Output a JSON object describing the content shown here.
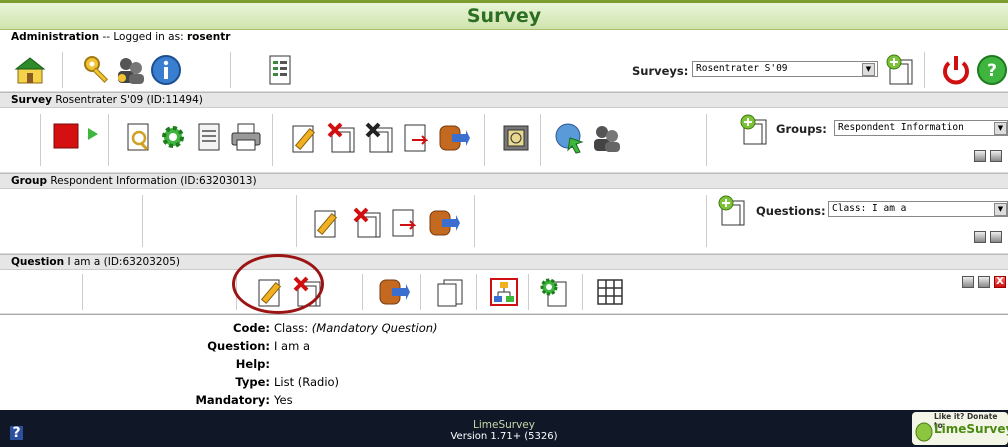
{
  "title": "Survey",
  "admin": {
    "label": "Administration",
    "logged_in_text": "-- Logged in as:",
    "user": "rosentr",
    "surveys_label": "Surveys:",
    "surveys_selected": "Rosentrater S'09"
  },
  "survey": {
    "label": "Survey",
    "name": "Rosentrater S'09 (ID:11494)",
    "groups_label": "Groups:",
    "groups_selected": "Respondent Information"
  },
  "group": {
    "label": "Group",
    "name": "Respondent Information (ID:63203013)",
    "questions_label": "Questions:",
    "questions_selected": "Class: I am a"
  },
  "question": {
    "label": "Question",
    "name": "I am a (ID:63203205)",
    "close_symbol": "X"
  },
  "details": {
    "code_label": "Code:",
    "code_value": "Class:",
    "code_note": "(Mandatory Question)",
    "question_label": "Question:",
    "question_value": "I am a",
    "help_label": "Help:",
    "help_value": "",
    "type_label": "Type:",
    "type_value": "List (Radio)",
    "mandatory_label": "Mandatory:",
    "mandatory_value": "Yes"
  },
  "footer": {
    "help_symbol": "?",
    "app_name": "LimeSurvey",
    "version": "Version 1.71+ (5326)",
    "donate_line1": "Like it? Donate to",
    "donate_line2": "LimeSurvey"
  },
  "colors": {
    "accent_green": "#2c6f23",
    "footer_bg": "#101828",
    "highlight_circle": "#9b1515"
  }
}
